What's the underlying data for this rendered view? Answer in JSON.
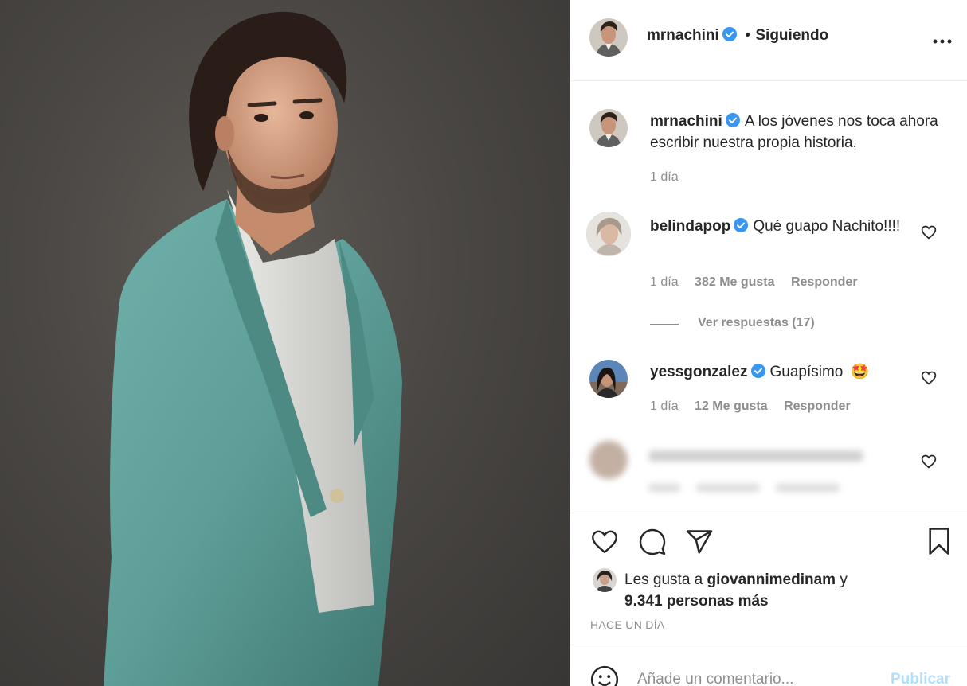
{
  "post_author": {
    "username": "mrnachini",
    "verified": true,
    "separator": "•",
    "follow_status": "Siguiendo",
    "more_icon": "more-horizontal-icon"
  },
  "caption": {
    "username": "mrnachini",
    "text": "A los jóvenes nos toca ahora escribir nuestra propia historia.",
    "time": "1 día"
  },
  "comments": [
    {
      "username": "belindapop",
      "verified": true,
      "text": "Qué guapo Nachito!!!!",
      "time": "1 día",
      "likes": "382 Me gusta",
      "reply_label": "Responder",
      "view_replies": "Ver respuestas (17)"
    },
    {
      "username": "yessgonzalez",
      "verified": true,
      "text": "Guapísimo",
      "emoji": "🤩",
      "time": "1 día",
      "likes": "12 Me gusta",
      "reply_label": "Responder"
    }
  ],
  "likes_summary": {
    "prefix": "Les gusta a",
    "liker": "giovannimedinam",
    "conjunction": "y",
    "others": "9.341 personas más"
  },
  "timestamp": "HACE UN DÍA",
  "composer": {
    "placeholder": "Añade un comentario...",
    "publish_label": "Publicar"
  },
  "colors": {
    "verified_blue": "#3897f0",
    "publish_disabled": "#b2dffc",
    "suit": "#5e9e98",
    "background_photo": "#4a4744"
  }
}
